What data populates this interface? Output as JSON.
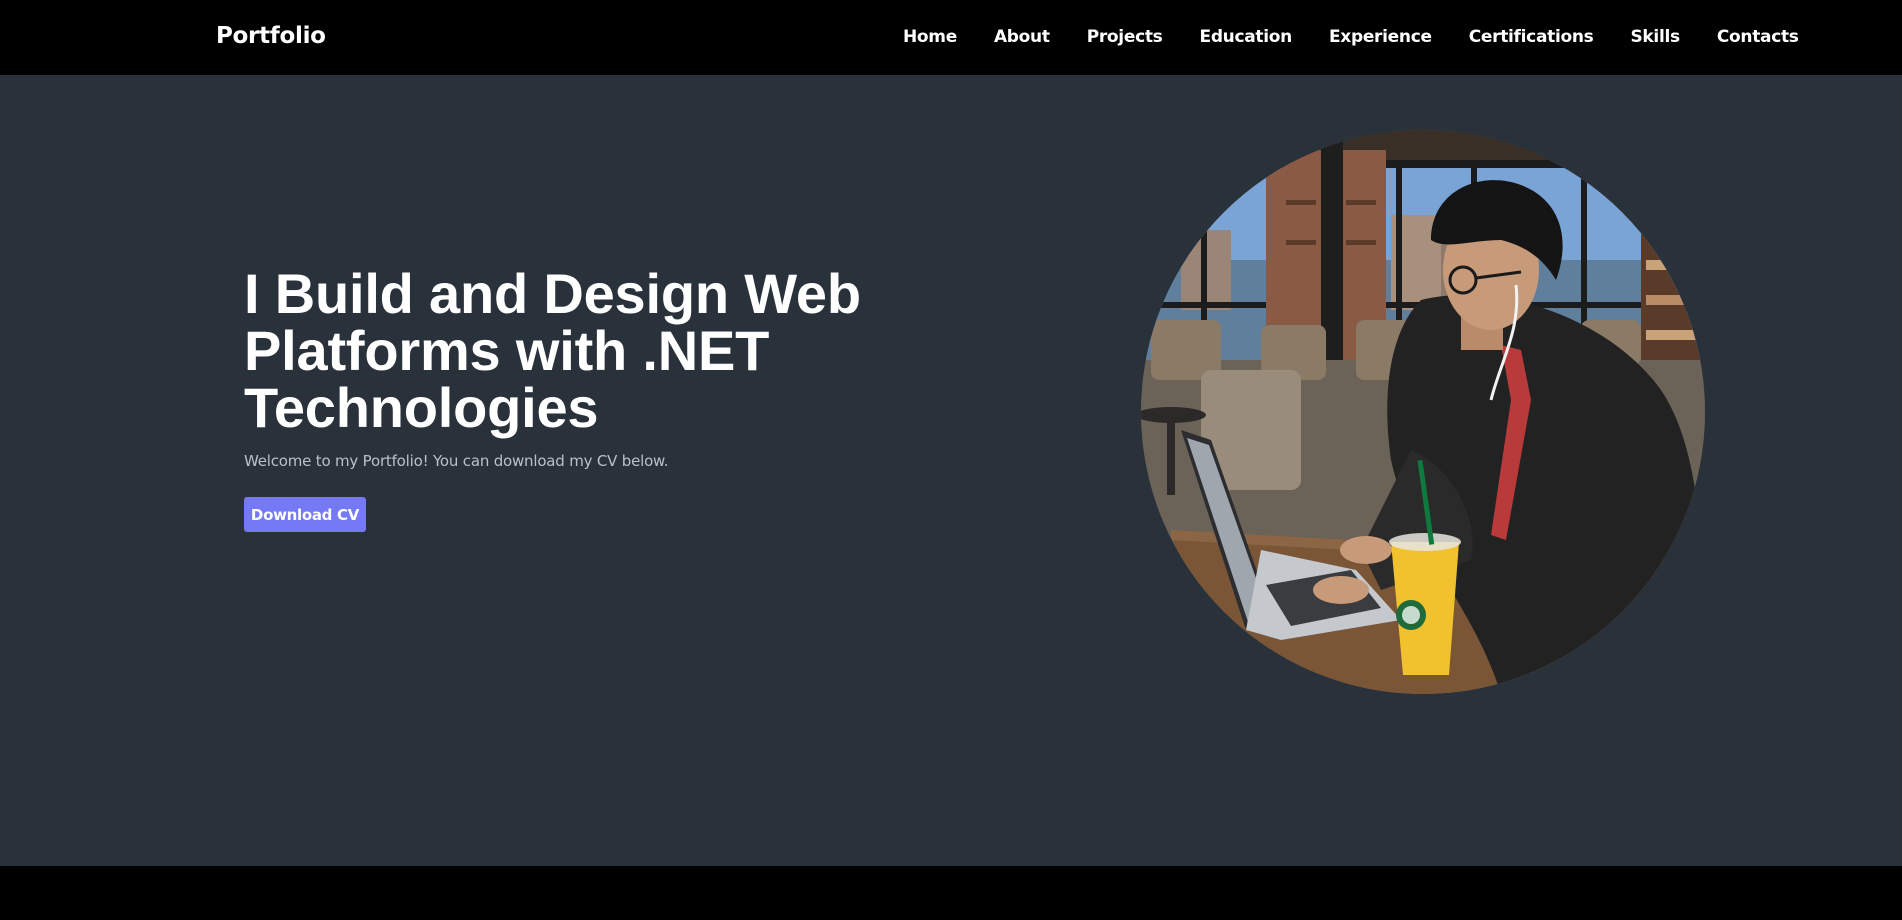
{
  "brand": "Portfolio",
  "nav": {
    "items": [
      {
        "label": "Home"
      },
      {
        "label": "About"
      },
      {
        "label": "Projects"
      },
      {
        "label": "Education"
      },
      {
        "label": "Experience"
      },
      {
        "label": "Certifications"
      },
      {
        "label": "Skills"
      },
      {
        "label": "Contacts"
      }
    ]
  },
  "hero": {
    "headline": "I Build and Design Web Platforms with .NET Technologies",
    "subtitle": "Welcome to my Portfolio! You can download my CV below.",
    "cta_label": "Download CV"
  },
  "colors": {
    "navbar_bg": "#000000",
    "hero_bg": "#29313b",
    "accent": "#7579f5",
    "text_primary": "#ffffff",
    "text_muted": "#b9c0c9"
  }
}
